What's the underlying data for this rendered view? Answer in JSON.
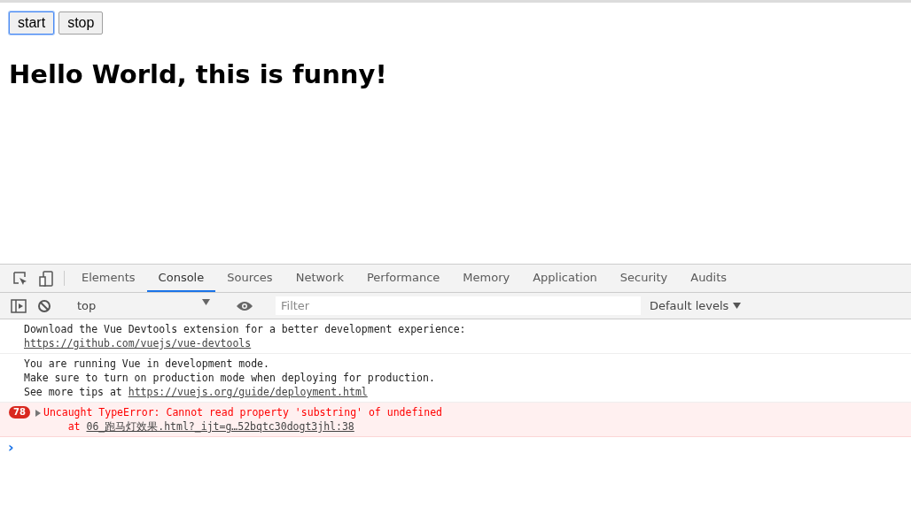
{
  "page": {
    "buttons": [
      {
        "label": "start",
        "focused": true
      },
      {
        "label": "stop",
        "focused": false
      }
    ],
    "heading": "Hello World, this is funny!"
  },
  "devtools": {
    "tabs": [
      {
        "label": "Elements",
        "selected": false
      },
      {
        "label": "Console",
        "selected": true
      },
      {
        "label": "Sources",
        "selected": false
      },
      {
        "label": "Network",
        "selected": false
      },
      {
        "label": "Performance",
        "selected": false
      },
      {
        "label": "Memory",
        "selected": false
      },
      {
        "label": "Application",
        "selected": false
      },
      {
        "label": "Security",
        "selected": false
      },
      {
        "label": "Audits",
        "selected": false
      }
    ],
    "context": "top",
    "filter": {
      "placeholder": "Filter"
    },
    "levels": "Default levels",
    "messages": [
      {
        "kind": "log",
        "lines": [
          {
            "text": "Download the Vue Devtools extension for a better development experience:"
          },
          {
            "link": "https://github.com/vuejs/vue-devtools"
          }
        ]
      },
      {
        "kind": "log",
        "lines": [
          {
            "text": "You are running Vue in development mode."
          },
          {
            "text": "Make sure to turn on production mode when deploying for production."
          },
          {
            "text": "See more tips at ",
            "link": "https://vuejs.org/guide/deployment.html"
          }
        ]
      },
      {
        "kind": "error",
        "count": "78",
        "lines": [
          {
            "text": "Uncaught TypeError: Cannot read property 'substring' of undefined"
          },
          {
            "text": "    at ",
            "link": "06_跑马灯效果.html?_ijt=g…52bqtc30dogt3jhl:38"
          }
        ]
      }
    ],
    "prompt": "›"
  }
}
